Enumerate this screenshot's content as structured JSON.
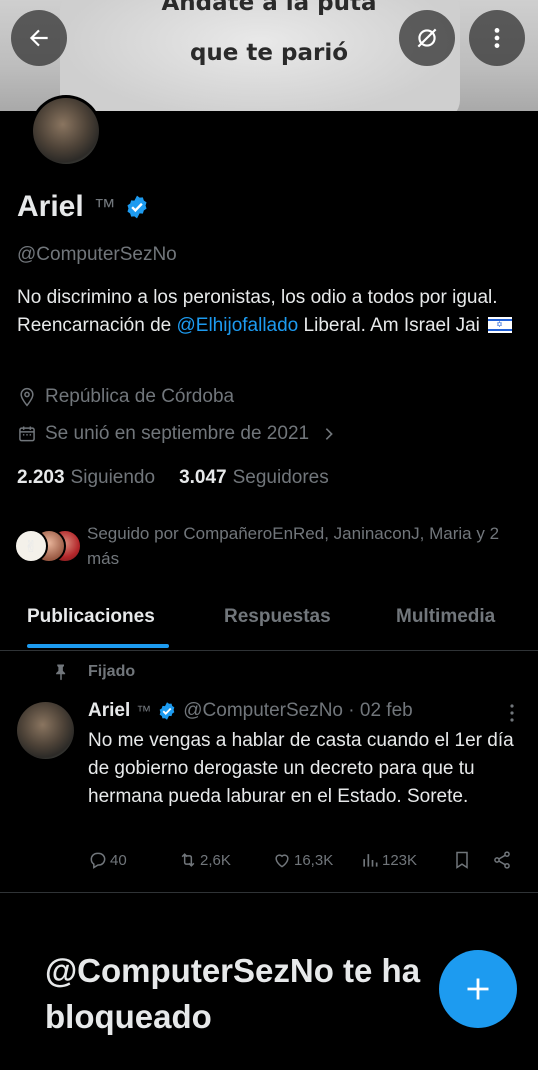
{
  "banner": {
    "line1": "Andate a la puta",
    "line2": "que te parió"
  },
  "profile": {
    "name": "Ariel",
    "suffix": "™",
    "handle": "@ComputerSezNo",
    "bio_part1": "No discrimino a los peronistas, los odio a todos por igual. Reencarnación de ",
    "bio_mention": "@Elhijofallado",
    "bio_part2": " Liberal. Am Israel Jai ",
    "location": "República de Córdoba",
    "joined": "Se unió en septiembre de 2021",
    "following_count": "2.203",
    "following_label": "Siguiendo",
    "followers_count": "3.047",
    "followers_label": "Seguidores",
    "followed_by": "Seguido por CompañeroEnRed, JaninaconJ, Maria y 2 más"
  },
  "tabs": [
    {
      "label": "Publicaciones",
      "active": true
    },
    {
      "label": "Respuestas",
      "active": false
    },
    {
      "label": "Multimedia",
      "active": false
    }
  ],
  "post": {
    "pinned_label": "Fijado",
    "author": "Ariel",
    "suffix": "™",
    "meta": "@ComputerSezNo · 02 feb",
    "text": "No me vengas a hablar de casta cuando el 1er día de gobierno derogaste un decreto para que tu hermana pueda laburar en el Estado. Sorete.",
    "replies": "40",
    "reposts": "2,6K",
    "likes": "16,3K",
    "views": "123K"
  },
  "blocked_message": "@ComputerSezNo te ha bloqueado",
  "icons": {
    "back": "arrow-left-icon",
    "spaces": "no-sync-icon",
    "more": "more-vertical-icon",
    "verified": "verified-badge-icon",
    "location": "location-pin-icon",
    "calendar": "calendar-icon",
    "pin": "pin-icon",
    "reply": "reply-icon",
    "repost": "repost-icon",
    "like": "heart-icon",
    "views": "views-icon",
    "bookmark": "bookmark-icon",
    "share": "share-icon",
    "compose": "plus-icon"
  },
  "colors": {
    "accent": "#1d9bf0",
    "background": "#000000",
    "text": "#e7e9ea",
    "muted": "#71767b"
  }
}
